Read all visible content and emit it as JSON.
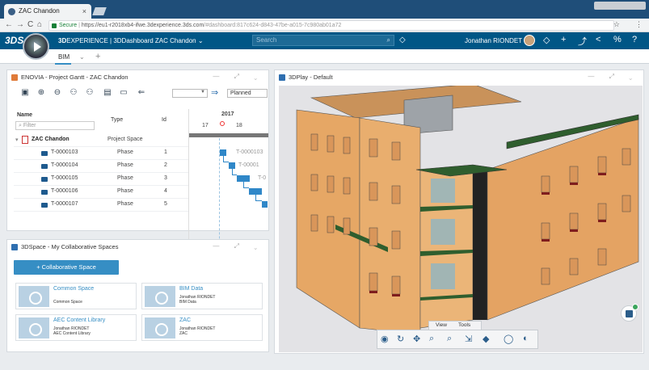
{
  "browser": {
    "tab_title": "ZAC Chandon",
    "tab_close": "×",
    "secure_label": "Secure",
    "url_host": "https://eu1-r2018xb4-ifwe.3dexperience.3ds.com",
    "url_path": "/#dashboard:817c624-d843-47be-a015-7c980ab01a72",
    "nav_back": "←",
    "nav_forward": "→",
    "nav_reload": "C",
    "nav_home": "⌂",
    "star": "☆",
    "menu": "⋮"
  },
  "app": {
    "brand_logo": "3DS",
    "title_bold": "3D",
    "title_rest": "EXPERIENCE | 3DDashboard ZAC Chandon ⌄",
    "search_placeholder": "Search",
    "search_icon": "search-icon",
    "user_name": "Jonathan RIONDET",
    "header_icons": [
      "◇",
      "+",
      "⤴",
      "<",
      "%",
      "?"
    ],
    "dashboard_tab": "BIM",
    "dashboard_tab_chevron": "⌄",
    "add_tab": "+"
  },
  "gantt_panel": {
    "title": "ENOVIA - Project Gantt - ZAC Chandon",
    "controls": "— ⤢ ⌄",
    "toolbar_icons": [
      "▣",
      "⊕",
      "⊖",
      "⚇",
      "⚇",
      "▤",
      "▭",
      "⇐"
    ],
    "status_select": "Planned",
    "columns": {
      "name": "Name",
      "type": "Type",
      "id": "Id"
    },
    "filter_placeholder": "Filter",
    "timeline_year": "2017",
    "timeline_weeks": [
      "17",
      "18"
    ],
    "root": {
      "name": "ZAC Chandon",
      "type": "Project Space"
    },
    "rows": [
      {
        "name": "T-0000103",
        "type": "Phase",
        "id": "1"
      },
      {
        "name": "T-0000104",
        "type": "Phase",
        "id": "2"
      },
      {
        "name": "T-0000105",
        "type": "Phase",
        "id": "3"
      },
      {
        "name": "T-0000106",
        "type": "Phase",
        "id": "4"
      },
      {
        "name": "T-0000107",
        "type": "Phase",
        "id": "5"
      }
    ],
    "bar_labels": [
      "T-0000103",
      "T-00001",
      "T-0"
    ]
  },
  "collab_panel": {
    "title": "3DSpace - My Collaborative Spaces",
    "controls": "— ⤢ ⌄",
    "add_button": "+ Collaborative Space",
    "cards": [
      {
        "title": "Common Space",
        "lines": [
          "Common Space"
        ]
      },
      {
        "title": "BIM Data",
        "lines": [
          "Jonathan RIONDET",
          "BIM Data"
        ]
      },
      {
        "title": "AEC Content Library",
        "lines": [
          "Jonathan RIONDET",
          "AEC Content Library"
        ]
      },
      {
        "title": "ZAC",
        "lines": [
          "Jonathan RIONDET",
          "ZAC"
        ]
      }
    ]
  },
  "play_panel": {
    "title": "3DPlay - Default",
    "controls": "— ⤢ ⌄",
    "view_tabs": [
      "View",
      "Tools"
    ],
    "toolbar_icons": [
      "◉",
      "↻",
      "✥",
      "⌕",
      "⌕",
      "⇲",
      "◆",
      "◯",
      "◐"
    ]
  },
  "colors": {
    "app_blue": "#005686",
    "accent": "#368ec4",
    "facade": "#e6a765",
    "roof_green": "#2f5e2e",
    "enovia_icon": "#e07b39",
    "space_icon": "#2f6fb0",
    "play_icon": "#2f6fb0"
  }
}
